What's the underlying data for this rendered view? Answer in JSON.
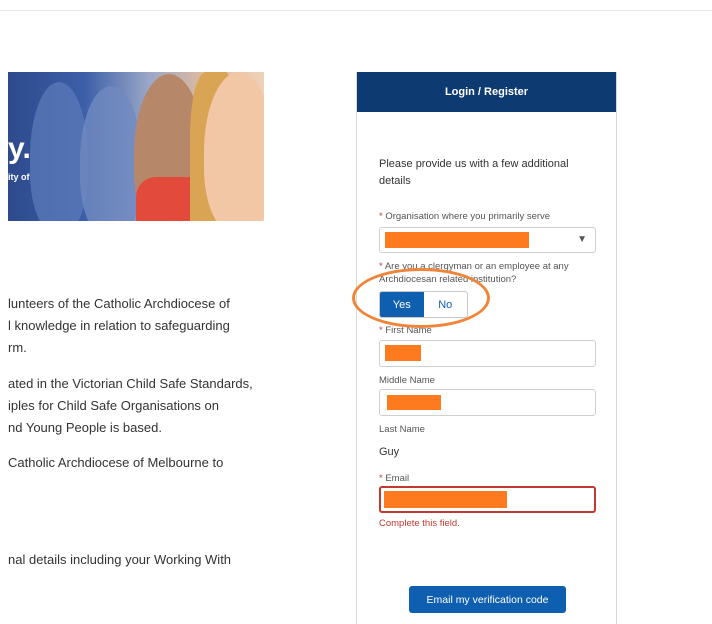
{
  "hero": {
    "tagline_big": "y.",
    "tagline_small": "ity of"
  },
  "body_text": {
    "p1": [
      "lunteers of the Catholic Archdiocese of",
      "l knowledge in relation to safeguarding",
      "rm."
    ],
    "p2": [
      "ated in the Victorian Child Safe Standards,",
      "iples for Child Safe Organisations on",
      "nd Young People is based."
    ],
    "p3": [
      "Catholic Archdiocese of Melbourne to"
    ],
    "p4": [
      "nal details including your Working With"
    ]
  },
  "panel": {
    "header": "Login / Register",
    "intro": "Please provide us with a few additional details",
    "org_label": "Organisation where you primarily serve",
    "clergy_label": "Are you a clergyman or an employee at any Archdiocesan related institution?",
    "clergy_options": {
      "yes": "Yes",
      "no": "No"
    },
    "clergy_selected": "Yes",
    "first_name_label": "First Name",
    "middle_name_label": "Middle Name",
    "last_name_label": "Last Name",
    "last_name_value": "Guy",
    "email_label": "Email",
    "email_error": "Complete this field.",
    "verify_button": "Email my verification code",
    "required_marker": "*"
  },
  "colors": {
    "header_bg": "#0e3a72",
    "primary": "#0f5fb0",
    "error": "#c23934",
    "redaction": "#fd7a1f",
    "highlight": "#f0853a"
  },
  "icons": {
    "select_chevron": "chevron-down-icon"
  }
}
